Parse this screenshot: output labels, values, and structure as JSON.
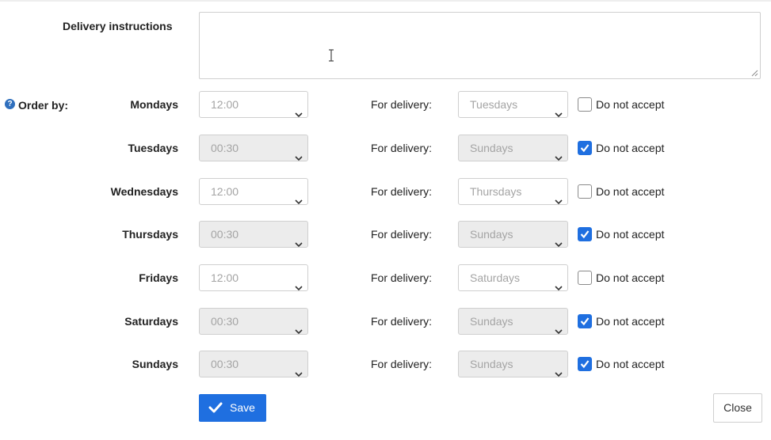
{
  "delivery_instructions": {
    "label": "Delivery instructions",
    "value": ""
  },
  "order_by": {
    "label": "Order by:",
    "help_icon": "question-circle-icon"
  },
  "for_delivery_label": "For delivery:",
  "do_not_accept_label": "Do not accept",
  "rows": [
    {
      "day": "Mondays",
      "time": "12:00",
      "delivery_day": "Tuesdays",
      "do_not_accept": false
    },
    {
      "day": "Tuesdays",
      "time": "00:30",
      "delivery_day": "Sundays",
      "do_not_accept": true
    },
    {
      "day": "Wednesdays",
      "time": "12:00",
      "delivery_day": "Thursdays",
      "do_not_accept": false
    },
    {
      "day": "Thursdays",
      "time": "00:30",
      "delivery_day": "Sundays",
      "do_not_accept": true
    },
    {
      "day": "Fridays",
      "time": "12:00",
      "delivery_day": "Saturdays",
      "do_not_accept": false
    },
    {
      "day": "Saturdays",
      "time": "00:30",
      "delivery_day": "Sundays",
      "do_not_accept": true
    },
    {
      "day": "Sundays",
      "time": "00:30",
      "delivery_day": "Sundays",
      "do_not_accept": true
    }
  ],
  "buttons": {
    "save": "Save",
    "close": "Close"
  },
  "colors": {
    "primary": "#1f6fe0",
    "disabled_bg": "#ececec",
    "placeholder_text": "#a4a4a4"
  }
}
